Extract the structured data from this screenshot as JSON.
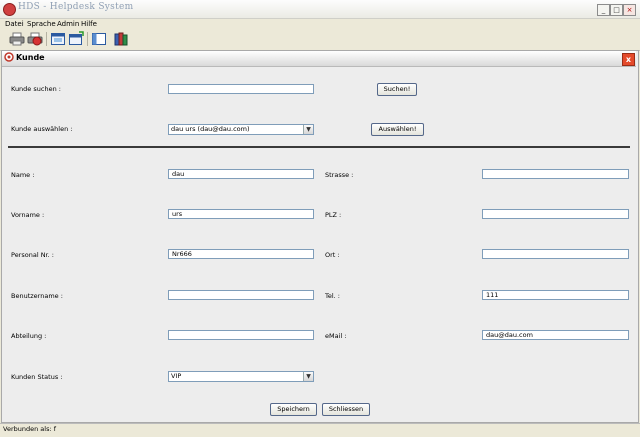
{
  "window": {
    "title": "HDS - Helpdesk System"
  },
  "menu": [
    "Datei",
    "Sprache",
    "Admin",
    "Hilfe"
  ],
  "toolbar": [
    "printer-icon",
    "printer-red-icon",
    "window-icon",
    "new-window-icon",
    "panel-icon",
    "books-icon"
  ],
  "frame": {
    "title": "Kunde",
    "close": "x"
  },
  "search": {
    "label": "Kunde suchen :",
    "value": "",
    "button": "Suchen!"
  },
  "select_customer": {
    "label": "Kunde auswählen :",
    "value": "dau urs (dau@dau.com)",
    "button": "Auswählen!"
  },
  "fields": {
    "name": {
      "label": "Name :",
      "value": "dau"
    },
    "vorname": {
      "label": "Vorname :",
      "value": "urs"
    },
    "personal_nr": {
      "label": "Personal Nr. :",
      "value": "Nr666"
    },
    "benutzername": {
      "label": "Benutzername :",
      "value": ""
    },
    "abteilung": {
      "label": "Abteilung :",
      "value": ""
    },
    "strasse": {
      "label": "Strasse :",
      "value": ""
    },
    "plz": {
      "label": "PLZ :",
      "value": ""
    },
    "ort": {
      "label": "Ort :",
      "value": ""
    },
    "tel": {
      "label": "Tel. :",
      "value": "111"
    },
    "email": {
      "label": "eMail :",
      "value": "dau@dau.com"
    }
  },
  "status": {
    "label": "Kunden Status :",
    "value": "VIP"
  },
  "buttons": {
    "save": "Speichern",
    "close": "Schliessen"
  },
  "statusbar": "Verbunden als: f"
}
